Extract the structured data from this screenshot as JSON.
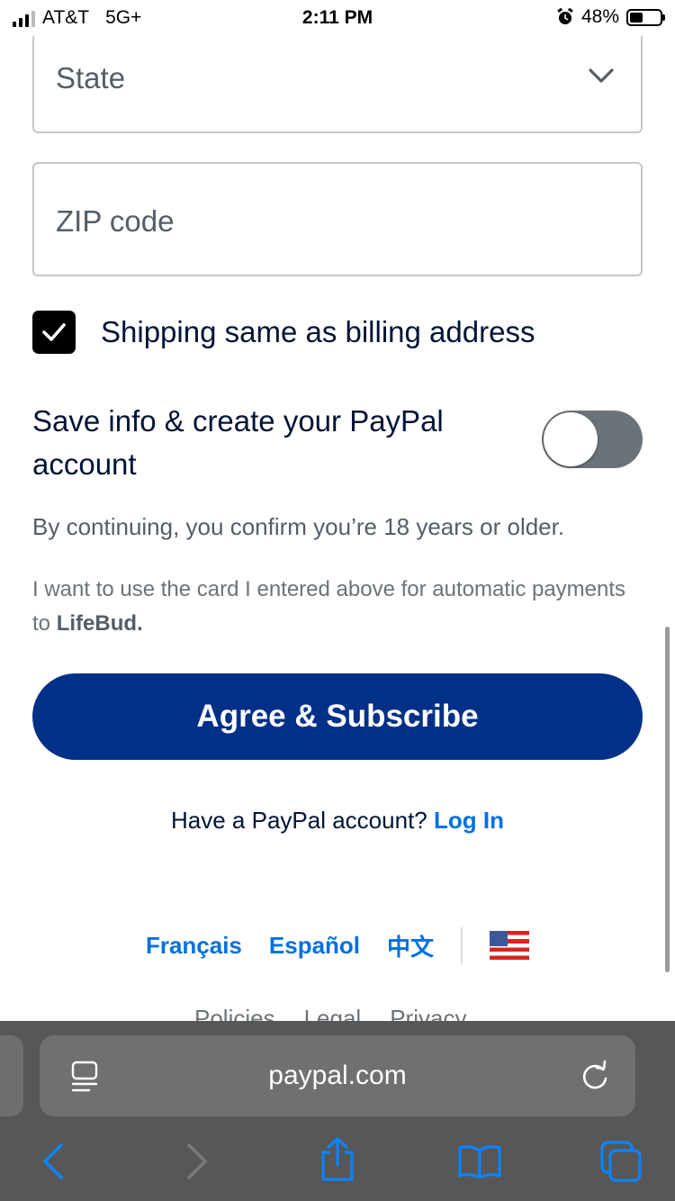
{
  "status_bar": {
    "carrier": "AT&T",
    "network": "5G+",
    "time": "2:11 PM",
    "battery": "48%",
    "battery_level": 0.48
  },
  "form": {
    "state_placeholder": "State",
    "zip_placeholder": "ZIP code",
    "shipping_same": {
      "label": "Shipping same as billing address",
      "checked": true
    },
    "save_info": {
      "label": "Save info & create your PayPal account",
      "enabled": false
    },
    "age_notice": "By continuing, you confirm you’re 18 years or older.",
    "autopay_text": "I want to use the card I entered above for automatic payments to ",
    "merchant": "LifeBud",
    "autopay_suffix": "."
  },
  "actions": {
    "subscribe_label": "Agree & Subscribe",
    "have_account_text": "Have a PayPal account?",
    "login_label": "Log In"
  },
  "footer": {
    "languages": [
      "Français",
      "Español",
      "中文"
    ],
    "links": [
      "Policies",
      "Legal",
      "Privacy"
    ]
  },
  "browser": {
    "url": "paypal.com"
  },
  "colors": {
    "primary_button": "#003087",
    "link": "#0070e0",
    "text": "#001435",
    "toolbar_icon": "#0a84ff"
  },
  "icons": [
    "signal-icon",
    "alarm-icon",
    "battery-icon",
    "chevron-down-icon",
    "checkmark-icon",
    "us-flag-icon",
    "reader-icon",
    "reload-icon",
    "back-icon",
    "forward-icon",
    "share-icon",
    "bookmarks-icon",
    "tabs-icon"
  ]
}
